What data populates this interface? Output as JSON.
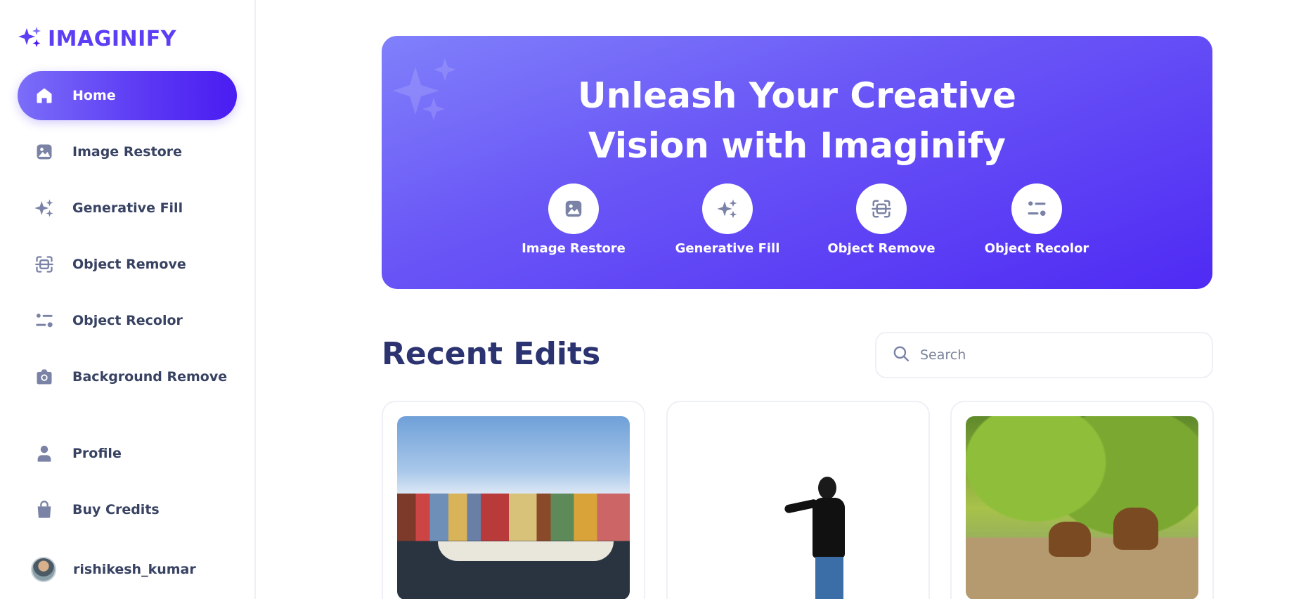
{
  "app": {
    "brand": "IMAGINIFY"
  },
  "sidebar": {
    "items": [
      {
        "label": "Home",
        "icon": "home-icon",
        "active": true
      },
      {
        "label": "Image Restore",
        "icon": "image-icon"
      },
      {
        "label": "Generative Fill",
        "icon": "sparkles-icon"
      },
      {
        "label": "Object Remove",
        "icon": "scan-icon"
      },
      {
        "label": "Object Recolor",
        "icon": "filter-icon"
      },
      {
        "label": "Background Remove",
        "icon": "camera-icon"
      }
    ],
    "bottom_items": [
      {
        "label": "Profile",
        "icon": "user-icon"
      },
      {
        "label": "Buy Credits",
        "icon": "bag-icon"
      }
    ],
    "user": {
      "name": "rishikesh_kumar"
    }
  },
  "hero": {
    "title_line1": "Unleash Your Creative",
    "title_line2": "Vision with Imaginify",
    "links": [
      {
        "label": "Image Restore",
        "icon": "image-icon"
      },
      {
        "label": "Generative Fill",
        "icon": "sparkles-icon"
      },
      {
        "label": "Object Remove",
        "icon": "scan-icon"
      },
      {
        "label": "Object Recolor",
        "icon": "filter-icon"
      }
    ]
  },
  "recent": {
    "title": "Recent Edits",
    "search_placeholder": "Search"
  },
  "colors": {
    "accent": "#5b3ff5",
    "hero_start": "#8080fb",
    "hero_end": "#4f2af4",
    "text": "#384262",
    "heading": "#2b3470",
    "icon": "#7a82a6"
  }
}
